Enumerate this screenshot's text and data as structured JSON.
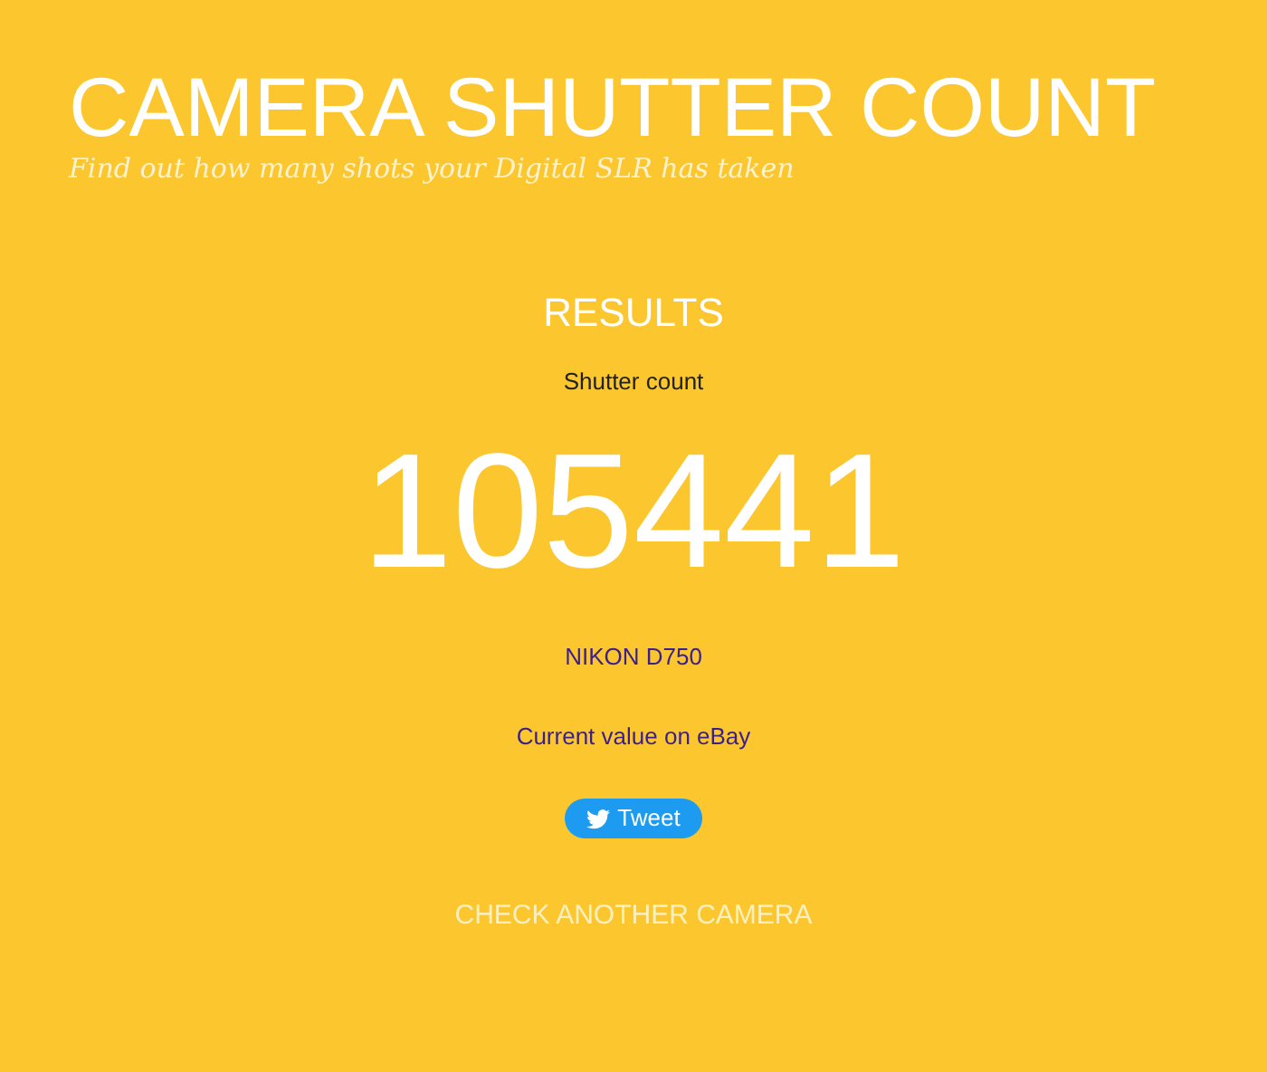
{
  "header": {
    "title": "CAMERA SHUTTER COUNT",
    "tagline": "Find out how many shots your Digital SLR has taken"
  },
  "results": {
    "heading": "RESULTS",
    "label": "Shutter count",
    "count": "105441",
    "camera_link": "NIKON D750",
    "value_link": "Current value on eBay",
    "tweet_button": "Tweet",
    "check_another": "CHECK ANOTHER CAMERA"
  }
}
